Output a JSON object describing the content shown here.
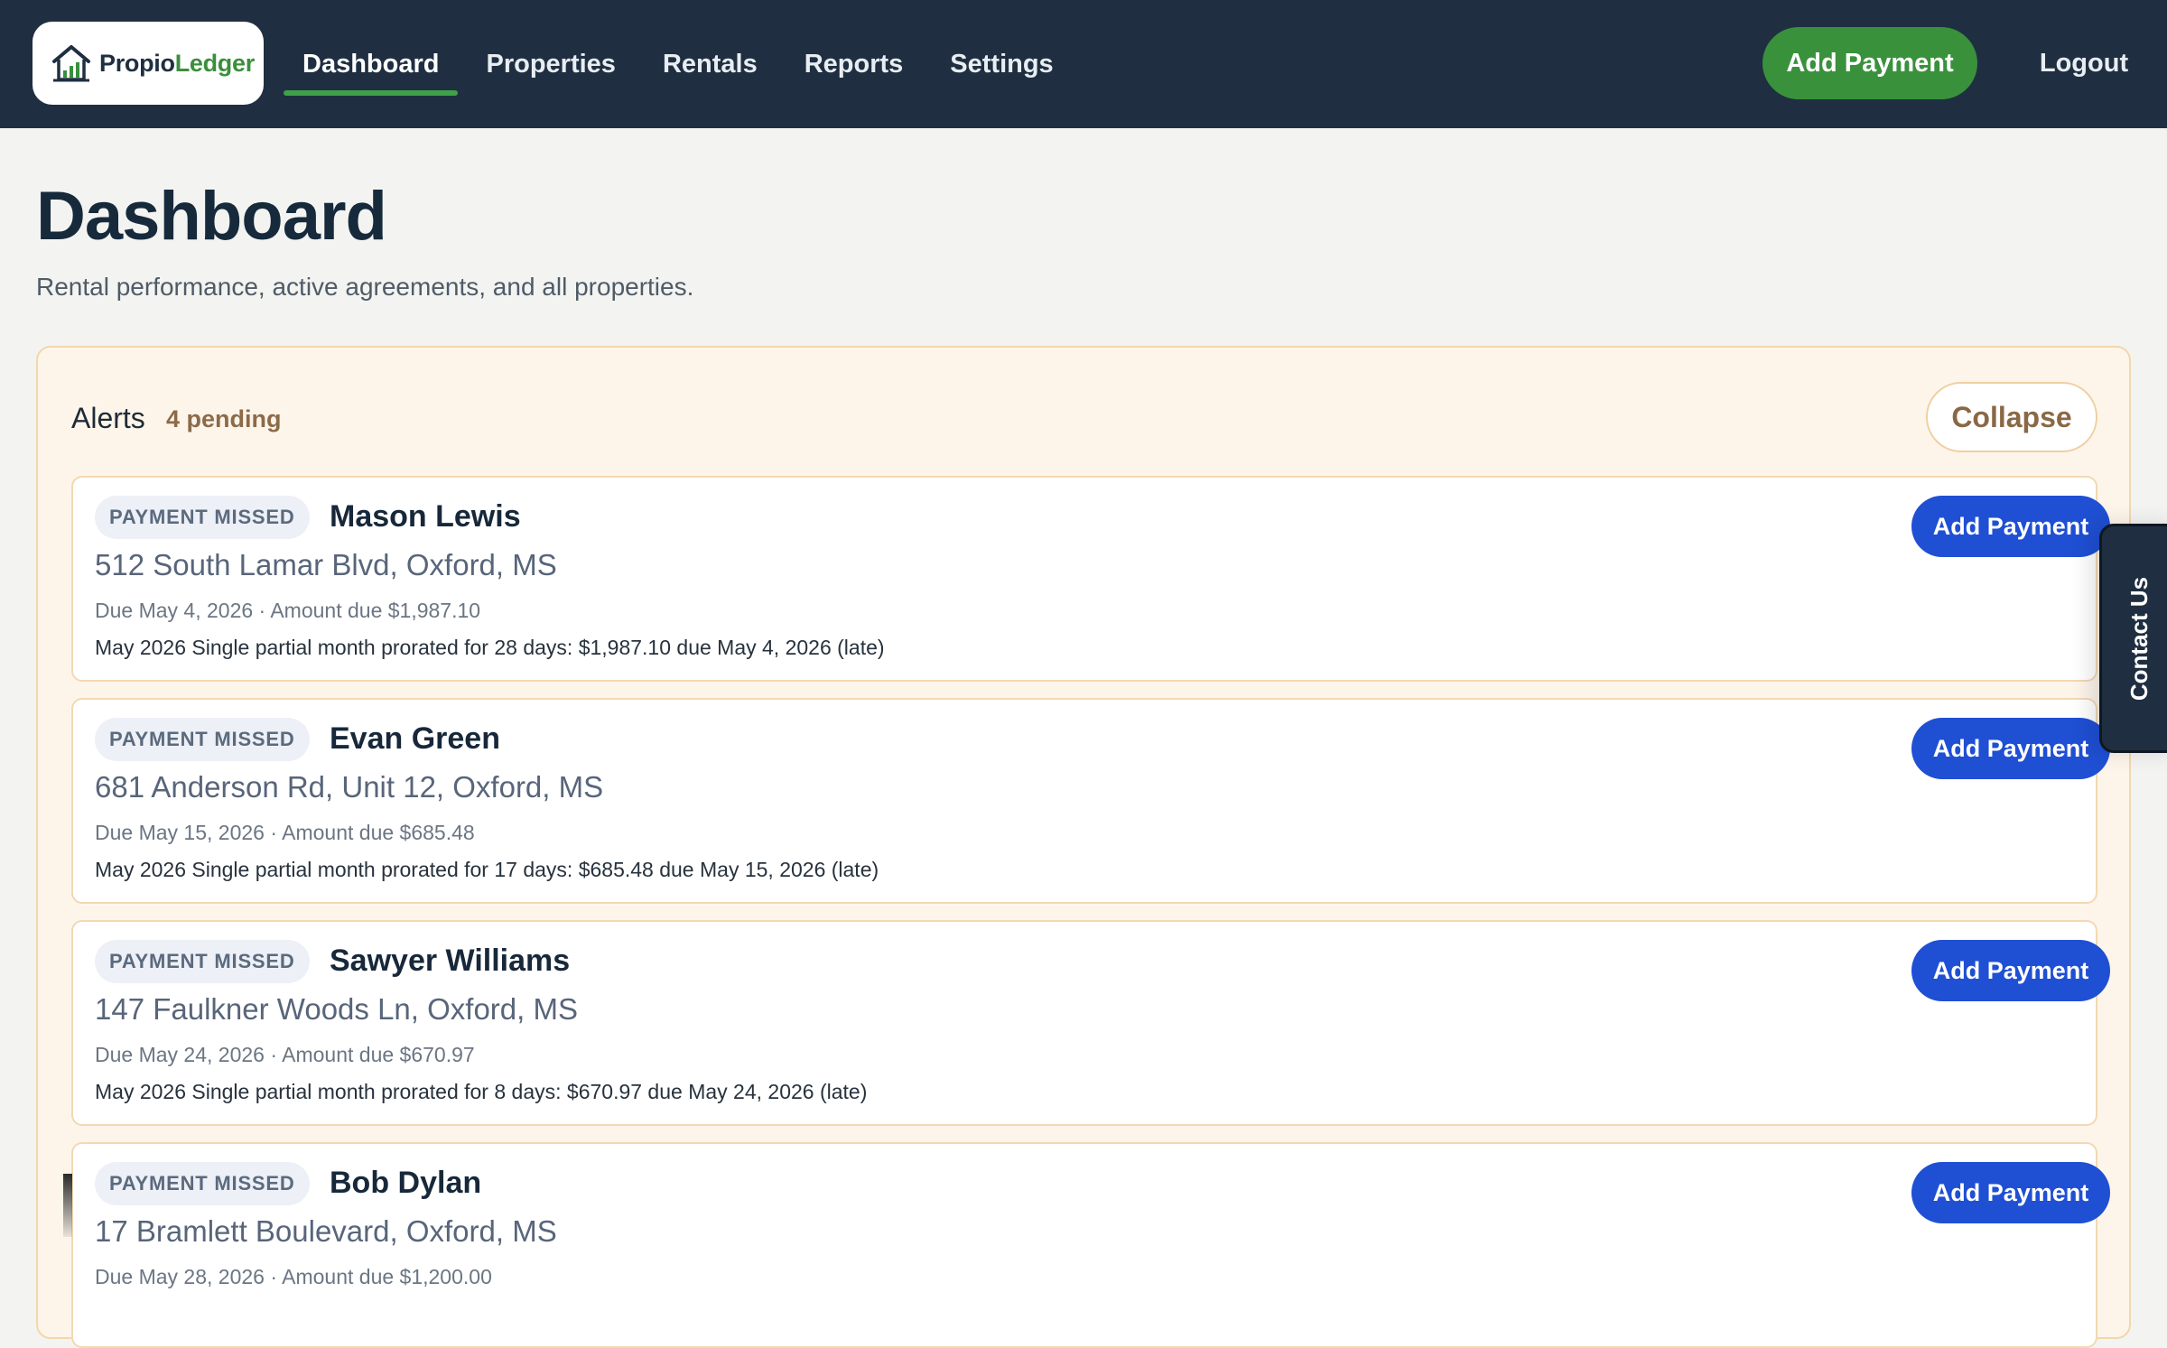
{
  "header": {
    "logo": {
      "part1": "Propio",
      "part2": "Ledger"
    },
    "nav": [
      {
        "label": "Dashboard",
        "active": true
      },
      {
        "label": "Properties"
      },
      {
        "label": "Rentals"
      },
      {
        "label": "Reports"
      },
      {
        "label": "Settings"
      }
    ],
    "add_payment_label": "Add Payment",
    "logout_label": "Logout"
  },
  "page": {
    "title": "Dashboard",
    "subtitle": "Rental performance, active agreements, and all properties."
  },
  "alerts": {
    "title": "Alerts",
    "count": "4 pending",
    "collapse_label": "Collapse",
    "items": [
      {
        "badge": "PAYMENT MISSED",
        "tenant": "Mason Lewis",
        "address": "512 South Lamar Blvd, Oxford, MS",
        "due": "Due May 4, 2026 · Amount due $1,987.10",
        "description": "May 2026 Single partial month prorated for 28 days: $1,987.10 due May 4, 2026 (late)",
        "action": "Add Payment"
      },
      {
        "badge": "PAYMENT MISSED",
        "tenant": "Evan Green",
        "address": "681 Anderson Rd, Unit 12, Oxford, MS",
        "due": "Due May 15, 2026 · Amount due $685.48",
        "description": "May 2026 Single partial month prorated for 17 days: $685.48 due May 15, 2026 (late)",
        "action": "Add Payment"
      },
      {
        "badge": "PAYMENT MISSED",
        "tenant": "Sawyer Williams",
        "address": "147 Faulkner Woods Ln, Oxford, MS",
        "due": "Due May 24, 2026 · Amount due $670.97",
        "description": "May 2026 Single partial month prorated for 8 days: $670.97 due May 24, 2026 (late)",
        "action": "Add Payment"
      },
      {
        "badge": "PAYMENT MISSED",
        "tenant": "Bob Dylan",
        "address": "17 Bramlett Boulevard, Oxford, MS",
        "due": "Due May 28, 2026 · Amount due $1,200.00",
        "description": "",
        "action": "Add Payment"
      }
    ]
  },
  "contact_tab": {
    "label": "Contact Us"
  },
  "icons": {
    "logo": "house-chart-icon"
  },
  "colors": {
    "header_bg": "#1f2f41",
    "accent_green": "#3a913c",
    "action_blue": "#1f4fd3",
    "alert_bg": "#fdf5ea",
    "alert_border": "#f2d7ae"
  }
}
